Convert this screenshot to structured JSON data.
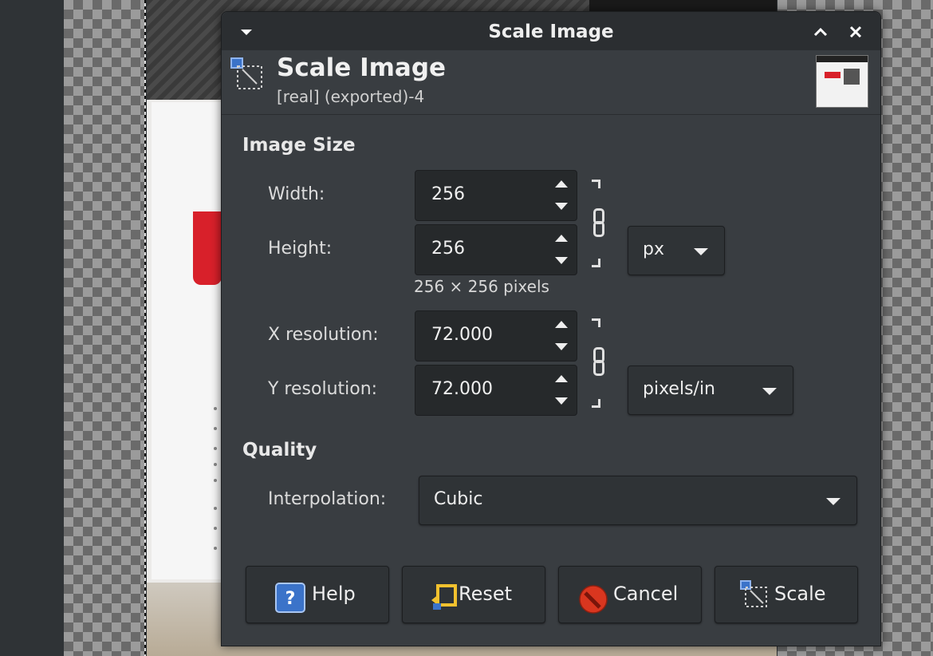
{
  "dialog": {
    "titlebar": {
      "title": "Scale Image"
    },
    "header": {
      "title": "Scale Image",
      "subtitle": "[real] (exported)-4"
    },
    "image_size": {
      "section_title": "Image Size",
      "width_label": "Width:",
      "width_value": "256",
      "height_label": "Height:",
      "height_value": "256",
      "size_unit": "px",
      "size_info": "256 × 256 pixels",
      "xres_label": "X resolution:",
      "xres_value": "72.000",
      "yres_label": "Y resolution:",
      "yres_value": "72.000",
      "res_unit": "pixels/in"
    },
    "quality": {
      "section_title": "Quality",
      "interpolation_label": "Interpolation:",
      "interpolation_value": "Cubic"
    },
    "buttons": {
      "help": "Help",
      "reset": "Reset",
      "cancel": "Cancel",
      "scale": "Scale"
    }
  },
  "colors": {
    "dialog_bg": "#393d41",
    "titlebar_bg": "#2b2e31",
    "field_bg": "#26292b",
    "help_icon": "#3b73c9",
    "cancel_icon": "#d9361f"
  },
  "icons": [
    "menu-arrow-icon",
    "maximize-icon",
    "close-icon",
    "scale-image-icon",
    "help-icon",
    "reset-icon",
    "cancel-icon",
    "scale-icon"
  ]
}
